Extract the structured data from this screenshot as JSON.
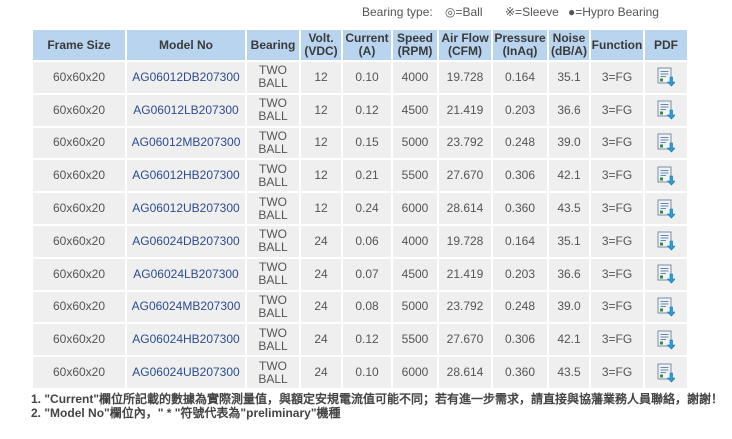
{
  "legend": {
    "title": "Bearing type:",
    "ball": "◎=Ball",
    "sleeve": "※=Sleeve",
    "hypro": "●=Hypro Bearing"
  },
  "table": {
    "headers": {
      "frame": "Frame Size",
      "model": "Model No",
      "bearing": "Bearing",
      "volt_1": "Volt.",
      "volt_2": "(VDC)",
      "current_1": "Current",
      "current_2": "(A)",
      "speed_1": "Speed",
      "speed_2": "(RPM)",
      "airflow_1": "Air Flow",
      "airflow_2": "(CFM)",
      "pressure_1": "Pressure",
      "pressure_2": "(InAq)",
      "noise_1": "Noise",
      "noise_2": "(dB/A)",
      "function": "Function",
      "pdf": "PDF"
    },
    "rows": [
      {
        "frame": "60x60x20",
        "model": "AG06012DB207300",
        "bearing_1": "TWO",
        "bearing_2": "BALL",
        "volt": "12",
        "current": "0.10",
        "speed": "4000",
        "airflow": "19.728",
        "pressure": "0.164",
        "noise": "35.1",
        "function": "3=FG"
      },
      {
        "frame": "60x60x20",
        "model": "AG06012LB207300",
        "bearing_1": "TWO",
        "bearing_2": "BALL",
        "volt": "12",
        "current": "0.12",
        "speed": "4500",
        "airflow": "21.419",
        "pressure": "0.203",
        "noise": "36.6",
        "function": "3=FG"
      },
      {
        "frame": "60x60x20",
        "model": "AG06012MB207300",
        "bearing_1": "TWO",
        "bearing_2": "BALL",
        "volt": "12",
        "current": "0.15",
        "speed": "5000",
        "airflow": "23.792",
        "pressure": "0.248",
        "noise": "39.0",
        "function": "3=FG"
      },
      {
        "frame": "60x60x20",
        "model": "AG06012HB207300",
        "bearing_1": "TWO",
        "bearing_2": "BALL",
        "volt": "12",
        "current": "0.21",
        "speed": "5500",
        "airflow": "27.670",
        "pressure": "0.306",
        "noise": "42.1",
        "function": "3=FG"
      },
      {
        "frame": "60x60x20",
        "model": "AG06012UB207300",
        "bearing_1": "TWO",
        "bearing_2": "BALL",
        "volt": "12",
        "current": "0.24",
        "speed": "6000",
        "airflow": "28.614",
        "pressure": "0.360",
        "noise": "43.5",
        "function": "3=FG"
      },
      {
        "frame": "60x60x20",
        "model": "AG06024DB207300",
        "bearing_1": "TWO",
        "bearing_2": "BALL",
        "volt": "24",
        "current": "0.06",
        "speed": "4000",
        "airflow": "19.728",
        "pressure": "0.164",
        "noise": "35.1",
        "function": "3=FG"
      },
      {
        "frame": "60x60x20",
        "model": "AG06024LB207300",
        "bearing_1": "TWO",
        "bearing_2": "BALL",
        "volt": "24",
        "current": "0.07",
        "speed": "4500",
        "airflow": "21.419",
        "pressure": "0.203",
        "noise": "36.6",
        "function": "3=FG"
      },
      {
        "frame": "60x60x20",
        "model": "AG06024MB207300",
        "bearing_1": "TWO",
        "bearing_2": "BALL",
        "volt": "24",
        "current": "0.08",
        "speed": "5000",
        "airflow": "23.792",
        "pressure": "0.248",
        "noise": "39.0",
        "function": "3=FG"
      },
      {
        "frame": "60x60x20",
        "model": "AG06024HB207300",
        "bearing_1": "TWO",
        "bearing_2": "BALL",
        "volt": "24",
        "current": "0.12",
        "speed": "5500",
        "airflow": "27.670",
        "pressure": "0.306",
        "noise": "42.1",
        "function": "3=FG"
      },
      {
        "frame": "60x60x20",
        "model": "AG06024UB207300",
        "bearing_1": "TWO",
        "bearing_2": "BALL",
        "volt": "24",
        "current": "0.10",
        "speed": "6000",
        "airflow": "28.614",
        "pressure": "0.360",
        "noise": "43.5",
        "function": "3=FG"
      }
    ]
  },
  "notes": {
    "note1": "1. \"Current\"欄位所記載的數據為實際測量值，與額定安規電流值可能不同；若有進一步需求，請直接與協藩業務人員聯絡，謝謝！",
    "note2": "2. \"Model No\"欄位內，\" * \"符號代表為\"preliminary\"機種"
  },
  "colors": {
    "header_bg": "#b8d4ee",
    "cell_bg": "#efefef",
    "model_link": "#2b4d8e"
  },
  "icons": {
    "pdf": "pdf-download-icon"
  }
}
